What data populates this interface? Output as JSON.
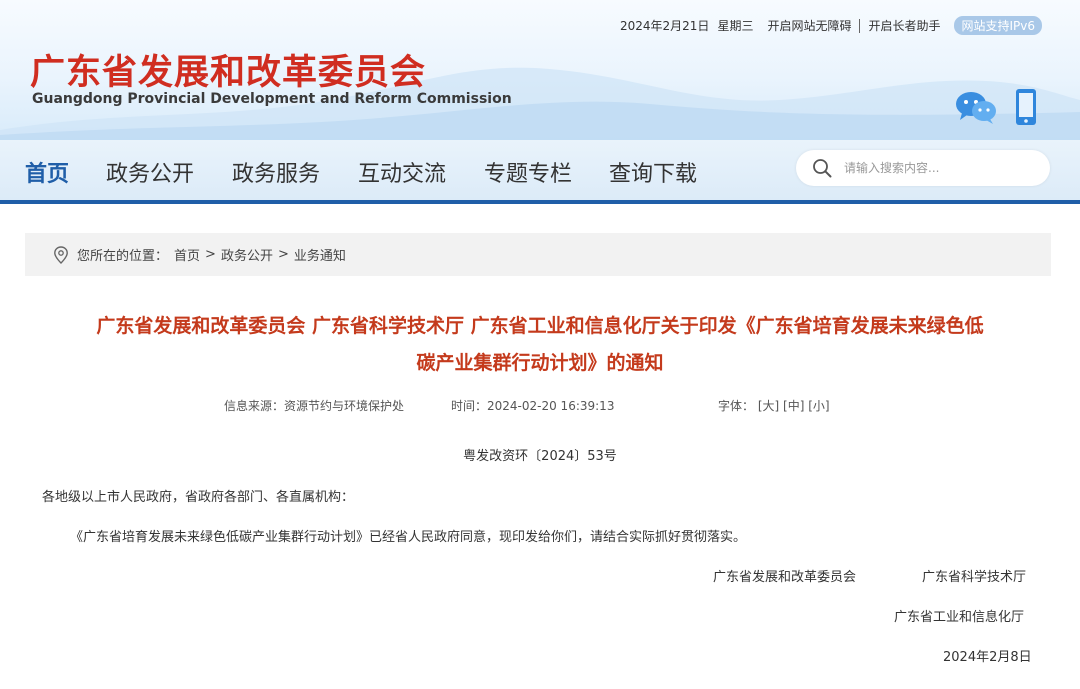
{
  "header": {
    "date": "2024年2月21日",
    "weekday": "星期三",
    "links": [
      "开启网站无障碍",
      "开启长者助手"
    ],
    "ipv6_badge": "网站支持IPv6",
    "logo_cn": "广东省发展和改革委员会",
    "logo_en": "Guangdong Provincial Development and Reform Commission"
  },
  "icons": [
    "wechat-icon",
    "mobile-icon",
    "search-icon",
    "location-pin-icon"
  ],
  "colors": {
    "brand_red": "#d02d20",
    "nav_blue": "#1f5ea8",
    "title_red": "#c43a1c"
  },
  "nav": {
    "items": [
      "首页",
      "政务公开",
      "政务服务",
      "互动交流",
      "专题专栏",
      "查询下载"
    ],
    "active_index": 0
  },
  "search": {
    "placeholder": "请输入搜索内容..."
  },
  "breadcrumb": {
    "label": "您所在的位置：",
    "items": [
      "首页",
      "政务公开",
      "业务通知"
    ],
    "separator": ">"
  },
  "article": {
    "title_line1": "广东省发展和改革委员会 广东省科学技术厅 广东省工业和信息化厅关于印发《广东省培育发展未来绿色低",
    "title_line2": "碳产业集群行动计划》的通知",
    "meta": {
      "source": "信息来源：资源节约与环境保护处",
      "time": "时间：2024-02-20 16:39:13",
      "font_label": "字体：",
      "font_large": "[大]",
      "font_medium": "[中]",
      "font_small": "[小]"
    },
    "doc_number": "粤发改资环〔2024〕53号",
    "salutation": "各地级以上市人民政府，省政府各部门、各直属机构：",
    "body": "《广东省培育发展未来绿色低碳产业集群行动计划》已经省人民政府同意，现印发给你们，请结合实际抓好贯彻落实。",
    "signatories": [
      "广东省发展和改革委员会",
      "广东省科学技术厅",
      "广东省工业和信息化厅"
    ],
    "sign_date": "2024年2月8日"
  }
}
